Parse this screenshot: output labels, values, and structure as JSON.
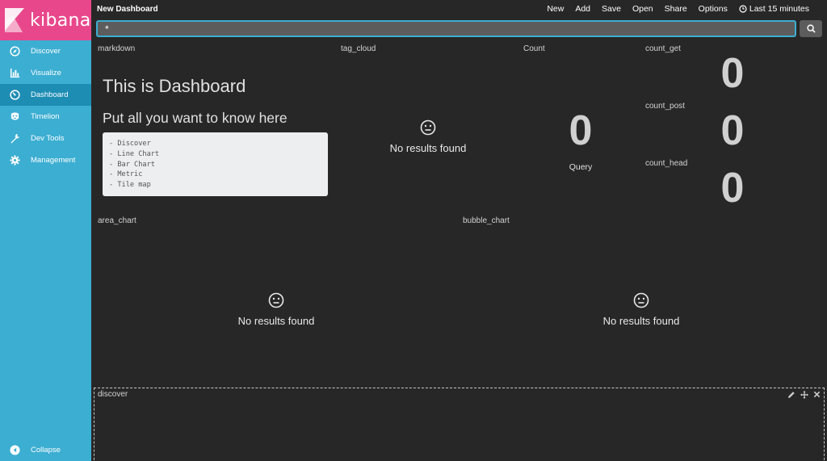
{
  "sidebar": {
    "brand": "kibana",
    "items": [
      {
        "label": "Discover",
        "icon": "compass-icon"
      },
      {
        "label": "Visualize",
        "icon": "bar-chart-icon"
      },
      {
        "label": "Dashboard",
        "icon": "dashboard-icon",
        "active": true
      },
      {
        "label": "Timelion",
        "icon": "timelion-icon"
      },
      {
        "label": "Dev Tools",
        "icon": "wrench-icon"
      },
      {
        "label": "Management",
        "icon": "gear-icon"
      }
    ],
    "collapse_label": "Collapse"
  },
  "header": {
    "title": "New Dashboard",
    "menu": {
      "new": "New",
      "add": "Add",
      "save": "Save",
      "open": "Open",
      "share": "Share",
      "options": "Options",
      "time": "Last 15 minutes"
    }
  },
  "search": {
    "value": "*"
  },
  "panels": {
    "markdown": {
      "title": "markdown",
      "heading1": "This is Dashboard",
      "heading2": "Put all you want to know here",
      "code_lines": [
        "- Discover",
        "- Line Chart",
        "- Bar Chart",
        "- Metric",
        "- Tile map"
      ]
    },
    "tag_cloud": {
      "title": "tag_cloud",
      "message": "No results found"
    },
    "count": {
      "title": "Count",
      "value": "0",
      "label": "Query"
    },
    "count_get": {
      "title": "count_get",
      "value": "0"
    },
    "count_post": {
      "title": "count_post",
      "value": "0"
    },
    "count_head": {
      "title": "count_head",
      "value": "0"
    },
    "area_chart": {
      "title": "area_chart",
      "message": "No results found"
    },
    "bubble_chart": {
      "title": "bubble_chart",
      "message": "No results found"
    },
    "discover": {
      "title": "discover"
    }
  },
  "colors": {
    "sidebar": "#3caed2",
    "logo_bg": "#e8488b",
    "active_nav": "#1e8db4",
    "background": "#272727"
  }
}
